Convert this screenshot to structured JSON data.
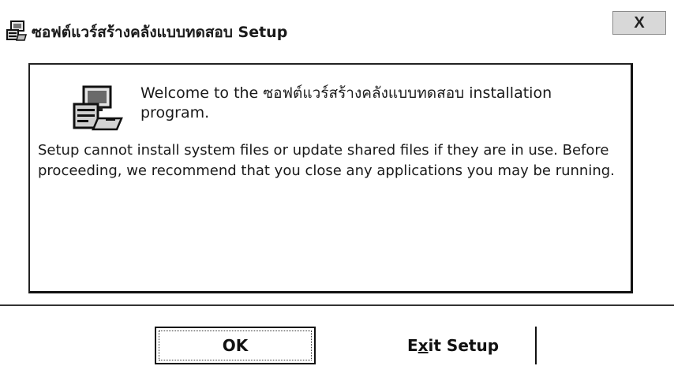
{
  "window": {
    "title": "ซอฟต์แวร์สร้างคลังแบบทดสอบ Setup",
    "close_label": "X"
  },
  "content": {
    "welcome": "Welcome to the ซอฟต์แวร์สร้างคลังแบบทดสอบ installation program.",
    "body": "Setup cannot install system files or update shared files if they are in use. Before proceeding, we recommend that you close any applications you may be running."
  },
  "buttons": {
    "ok_label": "OK",
    "exit_label_before": "E",
    "exit_label_mnemonic": "x",
    "exit_label_after": "it Setup"
  },
  "icons": {
    "title_icon": "setup-computer-icon",
    "setup_icon": "computer-install-icon"
  }
}
